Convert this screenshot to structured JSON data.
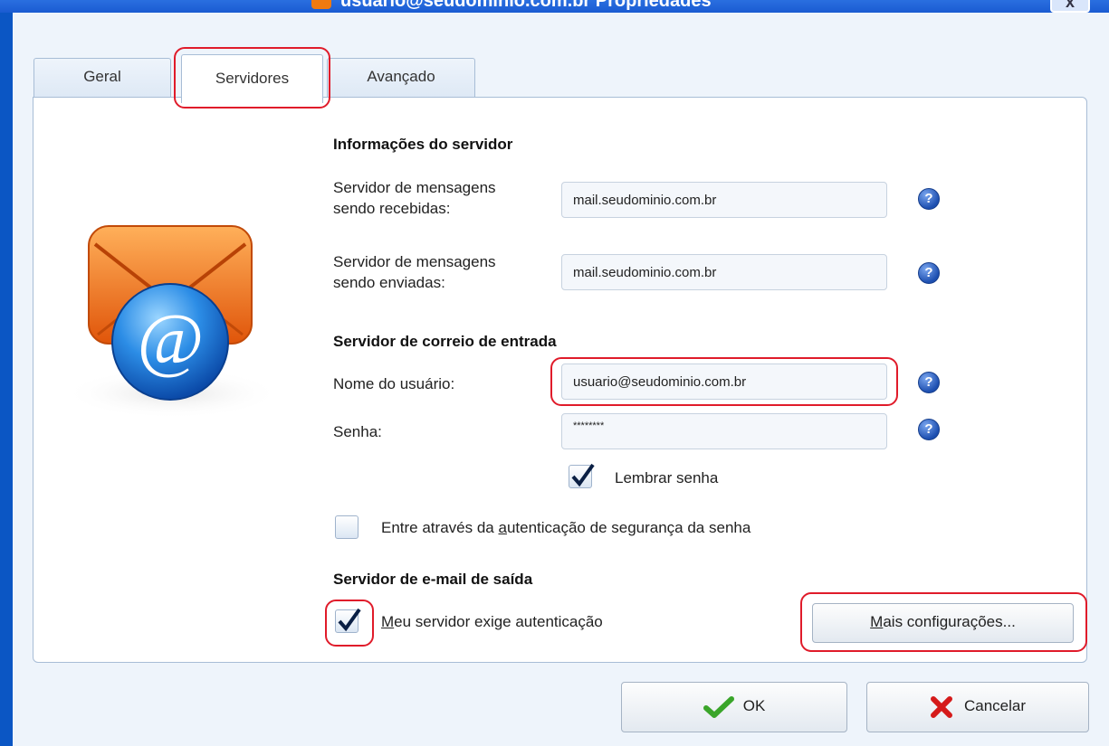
{
  "window": {
    "title": "usuario@seudominio.com.br Propriedades",
    "close_label": "x"
  },
  "tabs": [
    {
      "label": "Geral"
    },
    {
      "label": "Servidores"
    },
    {
      "label": "Avançado"
    }
  ],
  "server_info": {
    "heading": "Informações do servidor",
    "incoming_label_line1": "Servidor de mensagens",
    "incoming_label_line2": "sendo recebidas:",
    "incoming_value": "mail.seudominio.com.br",
    "outgoing_label_line1": "Servidor de mensagens",
    "outgoing_label_line2": "sendo enviadas:",
    "outgoing_value": "mail.seudominio.com.br"
  },
  "incoming_mail": {
    "heading": "Servidor de correio de entrada",
    "username_label": "Nome do usuário:",
    "username_value": "usuario@seudominio.com.br",
    "password_label": "Senha:",
    "password_value": "********",
    "remember_label": "Lembrar senha",
    "remember_checked": true,
    "spa_label_pre": "Entre através da ",
    "spa_label_accel": "a",
    "spa_label_post": "utenticação de segurança da senha",
    "spa_checked": false
  },
  "outgoing_mail": {
    "heading": "Servidor de e-mail de saída",
    "auth_label_accel": "M",
    "auth_label_post": "eu servidor exige autenticação",
    "auth_checked": true,
    "more_settings_accel": "M",
    "more_settings_post": "ais configurações..."
  },
  "buttons": {
    "ok_label": "OK",
    "cancel_label": "Cancelar"
  },
  "help_glyph": "?",
  "colors": {
    "highlight": "#e01b2a",
    "title_bar": "#1a5bd1",
    "ok_check": "#3aa52a",
    "cancel_x": "#d51a1a"
  }
}
